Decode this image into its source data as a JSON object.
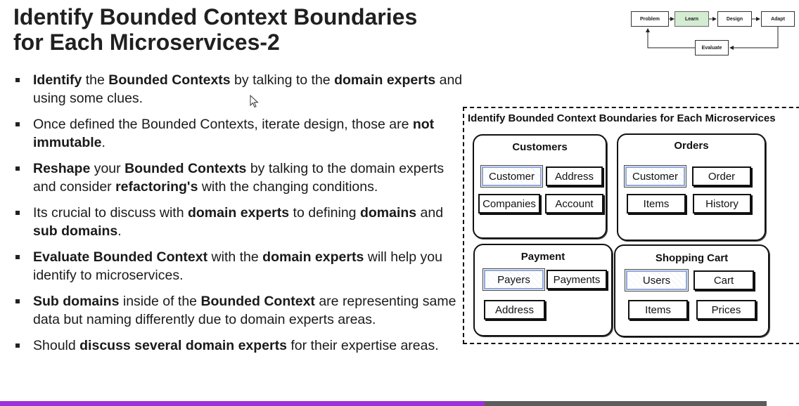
{
  "slide": {
    "title_line1": "Identify Bounded Context Boundaries",
    "title_line2": "for Each Microservices-2",
    "bullets": [
      [
        {
          "t": "Identify",
          "b": true
        },
        {
          "t": " the "
        },
        {
          "t": "Bounded Contexts",
          "b": true
        },
        {
          "t": " by talking to the "
        },
        {
          "t": "domain experts",
          "b": true
        },
        {
          "t": " and using some clues."
        }
      ],
      [
        {
          "t": "Once defined the Bounded Contexts, iterate design, those are "
        },
        {
          "t": "not immutable",
          "b": true
        },
        {
          "t": "."
        }
      ],
      [
        {
          "t": "Reshape",
          "b": true
        },
        {
          "t": " your "
        },
        {
          "t": "Bounded Contexts",
          "b": true
        },
        {
          "t": " by talking to the domain experts and consider "
        },
        {
          "t": "refactoring's",
          "b": true
        },
        {
          "t": " with the changing conditions."
        }
      ],
      [
        {
          "t": "Its crucial to discuss with "
        },
        {
          "t": "domain experts",
          "b": true
        },
        {
          "t": " to defining "
        },
        {
          "t": "domains",
          "b": true
        },
        {
          "t": " and "
        },
        {
          "t": "sub domains",
          "b": true
        },
        {
          "t": "."
        }
      ],
      [
        {
          "t": "Evaluate Bounded Context",
          "b": true
        },
        {
          "t": " with the "
        },
        {
          "t": "domain experts",
          "b": true
        },
        {
          "t": " will help you identify to microservices."
        }
      ],
      [
        {
          "t": "Sub domains",
          "b": true
        },
        {
          "t": " inside of the "
        },
        {
          "t": "Bounded Context",
          "b": true
        },
        {
          "t": " are representing same data but naming differently due to domain experts areas."
        }
      ],
      [
        {
          "t": "Should "
        },
        {
          "t": "discuss several domain experts",
          "b": true
        },
        {
          "t": " for their expertise areas."
        }
      ]
    ]
  },
  "flow": {
    "steps": [
      "Problem",
      "Learn",
      "Design",
      "Adapt"
    ],
    "feedback": "Evaluate",
    "active_step": "Learn"
  },
  "diagram": {
    "title": "Identify Bounded Context Boundaries for Each Microservices",
    "contexts": [
      {
        "name": "Customers",
        "entities": [
          "Customer",
          "Address",
          "Companies",
          "Account"
        ],
        "highlighted": [
          "Customer"
        ]
      },
      {
        "name": "Orders",
        "entities": [
          "Customer",
          "Order",
          "Items",
          "History"
        ],
        "highlighted": [
          "Customer"
        ]
      },
      {
        "name": "Payment",
        "entities": [
          "Payers",
          "Payments",
          "Address"
        ],
        "highlighted": [
          "Payers"
        ]
      },
      {
        "name": "Shopping Cart",
        "entities": [
          "Users",
          "Cart",
          "Items",
          "Prices"
        ],
        "highlighted": [
          "Users"
        ]
      }
    ]
  },
  "video": {
    "progress_fraction": 0.632
  },
  "colors": {
    "progress": "#9b30d9",
    "track": "#5c5c5c",
    "learn_box": "#d4ecd2",
    "highlight_border": "#8fa8d8"
  },
  "icons": [
    "mouse-cursor-icon"
  ]
}
